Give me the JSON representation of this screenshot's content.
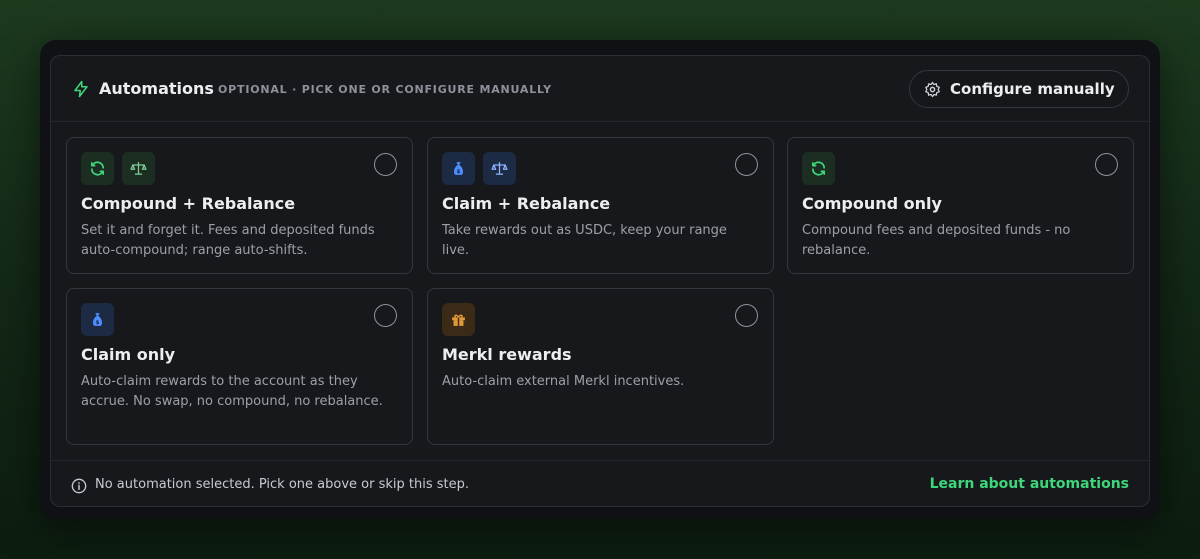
{
  "header": {
    "title": "Automations",
    "subtitle": "OPTIONAL · PICK ONE OR CONFIGURE MANUALLY",
    "icon": "lightning-icon",
    "configure_label": "Configure manually",
    "configure_icon": "gear-icon"
  },
  "cards": [
    {
      "title": "Compound + Rebalance",
      "desc": "Set it and forget it. Fees and deposited funds auto-compound; range auto-shifts.",
      "icons": [
        "refresh-icon",
        "scale-icon"
      ],
      "selected": false
    },
    {
      "title": "Claim + Rebalance",
      "desc": "Take rewards out as USDC, keep your range live.",
      "icons": [
        "money-bag-icon",
        "scale-icon"
      ],
      "selected": false
    },
    {
      "title": "Compound only",
      "desc": "Compound fees and deposited funds - no rebalance.",
      "icons": [
        "refresh-icon"
      ],
      "selected": false
    },
    {
      "title": "Claim only",
      "desc": "Auto-claim rewards to the account as they accrue. No swap, no compound, no rebalance.",
      "icons": [
        "money-bag-icon"
      ],
      "selected": false
    },
    {
      "title": "Merkl rewards",
      "desc": "Auto-claim external Merkl incentives.",
      "icons": [
        "gift-icon"
      ],
      "selected": false
    }
  ],
  "footer": {
    "status": "No automation selected. Pick one above or skip this step.",
    "info_icon": "info-icon",
    "learn_link": "Learn about automations"
  },
  "colors": {
    "accent_green": "#3ed67a",
    "blue_icon": "#4d8dff",
    "orange_icon": "#e49a3a",
    "panel_bg": "#16181c"
  }
}
